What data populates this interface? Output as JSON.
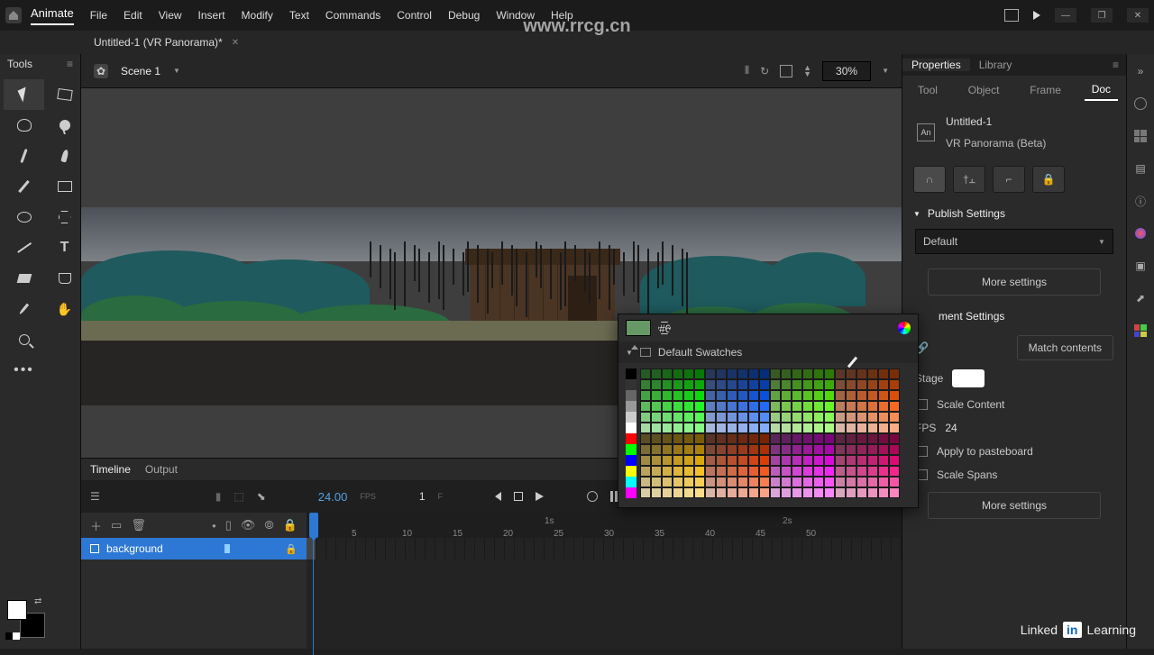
{
  "app": {
    "name": "Animate"
  },
  "menu": [
    "File",
    "Edit",
    "View",
    "Insert",
    "Modify",
    "Text",
    "Commands",
    "Control",
    "Debug",
    "Window",
    "Help"
  ],
  "watermark": "www.rrcg.cn",
  "document": {
    "tab": "Untitled-1 (VR Panorama)*"
  },
  "scene": {
    "name": "Scene 1",
    "zoom": "30%"
  },
  "tools_title": "Tools",
  "timeline": {
    "tabs": [
      "Timeline",
      "Output"
    ],
    "time": "24.00",
    "fps_label": "FPS",
    "frame": "1",
    "frame_label": "F",
    "ruler_seconds": [
      "1s",
      "2s"
    ],
    "ruler_frames": [
      "5",
      "10",
      "15",
      "20",
      "25",
      "30",
      "35",
      "40",
      "45",
      "50"
    ],
    "layers": [
      {
        "name": "background"
      }
    ]
  },
  "swatch_popup": {
    "hex": "#669966",
    "group": "Default Swatches",
    "left_column": [
      "#000000",
      "#333333",
      "#666666",
      "#999999",
      "#cccccc",
      "#ffffff",
      "#ff0000",
      "#00ff00",
      "#0000ff",
      "#ffff00",
      "#00ffff",
      "#ff00ff"
    ]
  },
  "properties": {
    "tabs": [
      "Properties",
      "Library"
    ],
    "modes": [
      "Tool",
      "Object",
      "Frame",
      "Doc"
    ],
    "active_mode": "Doc",
    "doc_name": "Untitled-1",
    "doc_type": "VR Panorama (Beta)",
    "doc_badge": "An",
    "publish_header": "Publish Settings",
    "profile": "Default",
    "more_settings": "More settings",
    "doc_settings_header": "ment Settings",
    "match_contents": "Match contents",
    "stage_label": "Stage",
    "fps_label": "FPS",
    "fps_value": "24",
    "checks": [
      "Scale Content",
      "Apply to pasteboard",
      "Scale Spans"
    ],
    "more_settings2": "More settings"
  },
  "footer_brand": {
    "linked": "Linked",
    "in": "in",
    "learning": "Learning"
  }
}
